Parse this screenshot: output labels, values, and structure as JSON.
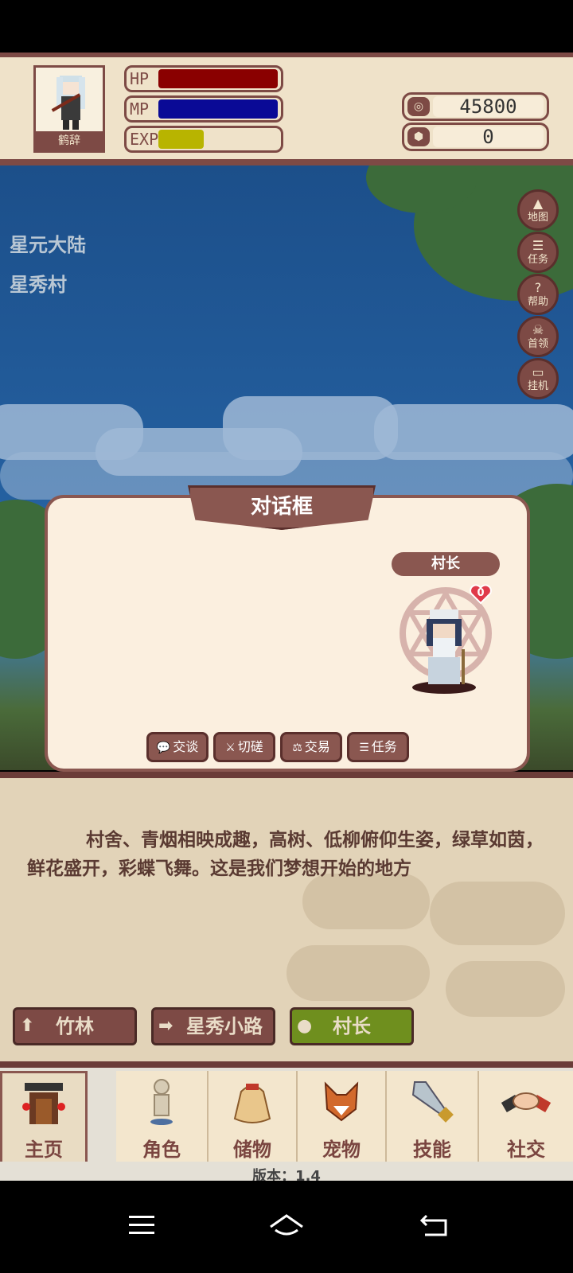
{
  "player": {
    "name": "鹤辞",
    "hp_label": "HP",
    "mp_label": "MP",
    "exp_label": "EXP",
    "hp_fraction": 1.0,
    "mp_fraction": 1.0,
    "exp_fraction": 0.38
  },
  "currency": {
    "gold_value": "45800",
    "gem_value": "0"
  },
  "location": {
    "continent": "星元大陆",
    "village": "星秀村"
  },
  "side_menu": [
    {
      "icon": "mountain-icon",
      "label": "地图"
    },
    {
      "icon": "scroll-icon",
      "label": "任务"
    },
    {
      "icon": "question-icon",
      "label": "帮助"
    },
    {
      "icon": "skull-icon",
      "label": "首领"
    },
    {
      "icon": "monitor-icon",
      "label": "挂机"
    }
  ],
  "dialog": {
    "title": "对话框",
    "npc_name": "村长",
    "affection": "0",
    "actions": [
      {
        "icon": "chat-icon",
        "label": "交谈"
      },
      {
        "icon": "sword-icon",
        "label": "切磋"
      },
      {
        "icon": "scale-icon",
        "label": "交易"
      },
      {
        "icon": "scroll-icon",
        "label": "任务"
      }
    ]
  },
  "description": "村舍、青烟相映成趣，高树、低柳俯仰生姿，绿草如茵，鲜花盛开，彩蝶飞舞。这是我们梦想开始的地方",
  "nav_buttons": [
    {
      "icon": "arrow-up-icon",
      "label": "竹林"
    },
    {
      "icon": "arrow-right-icon",
      "label": "星秀小路"
    },
    {
      "icon": "person-icon",
      "label": "村长"
    }
  ],
  "tabs": [
    {
      "icon": "house-icon",
      "label": "主页"
    },
    {
      "icon": "figure-icon",
      "label": "角色"
    },
    {
      "icon": "bag-icon",
      "label": "储物"
    },
    {
      "icon": "fox-icon",
      "label": "宠物"
    },
    {
      "icon": "dagger-icon",
      "label": "技能"
    },
    {
      "icon": "handshake-icon",
      "label": "社交"
    }
  ],
  "version": "版本：1.4",
  "colors": {
    "frame": "#7d4a45",
    "hp": "#8a0000",
    "mp": "#0a0a96",
    "exp": "#b8b400",
    "nav_npc": "#6f8f1e"
  }
}
